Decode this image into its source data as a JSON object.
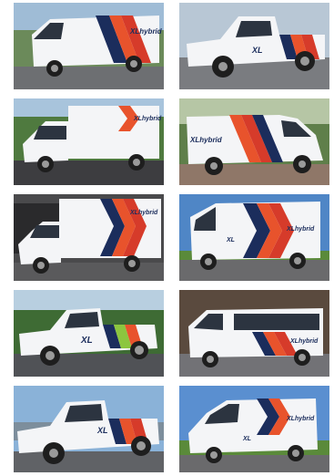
{
  "brand": {
    "logo_text": "XLhybrid",
    "badge_text": "XL"
  },
  "colors": {
    "stripe_orange": "#e8532c",
    "stripe_red": "#d63b2a",
    "stripe_navy": "#1b2d5c",
    "vehicle_white": "#f4f5f7",
    "accent_green": "#8cc63f"
  },
  "photos": [
    {
      "vehicle": "white box van with orange/navy chevron livery",
      "setting": "street with trees"
    },
    {
      "vehicle": "white pickup truck with red/navy stripes",
      "setting": "parking lot"
    },
    {
      "vehicle": "white box truck with chevron livery",
      "setting": "trees and lot"
    },
    {
      "vehicle": "white cargo van with chevron livery",
      "setting": "brick building"
    },
    {
      "vehicle": "white box truck with chevron livery",
      "setting": "garage"
    },
    {
      "vehicle": "white step van with chevron livery",
      "setting": "blue sky, grass"
    },
    {
      "vehicle": "white pickup with green/navy stripes",
      "setting": "trees and lot"
    },
    {
      "vehicle": "white shuttle bus with chevron livery",
      "setting": "building"
    },
    {
      "vehicle": "white pickup with red/navy stripes",
      "setting": "blue sky, mountains"
    },
    {
      "vehicle": "white sprinter van with chevron livery",
      "setting": "blue sky, grass"
    }
  ]
}
